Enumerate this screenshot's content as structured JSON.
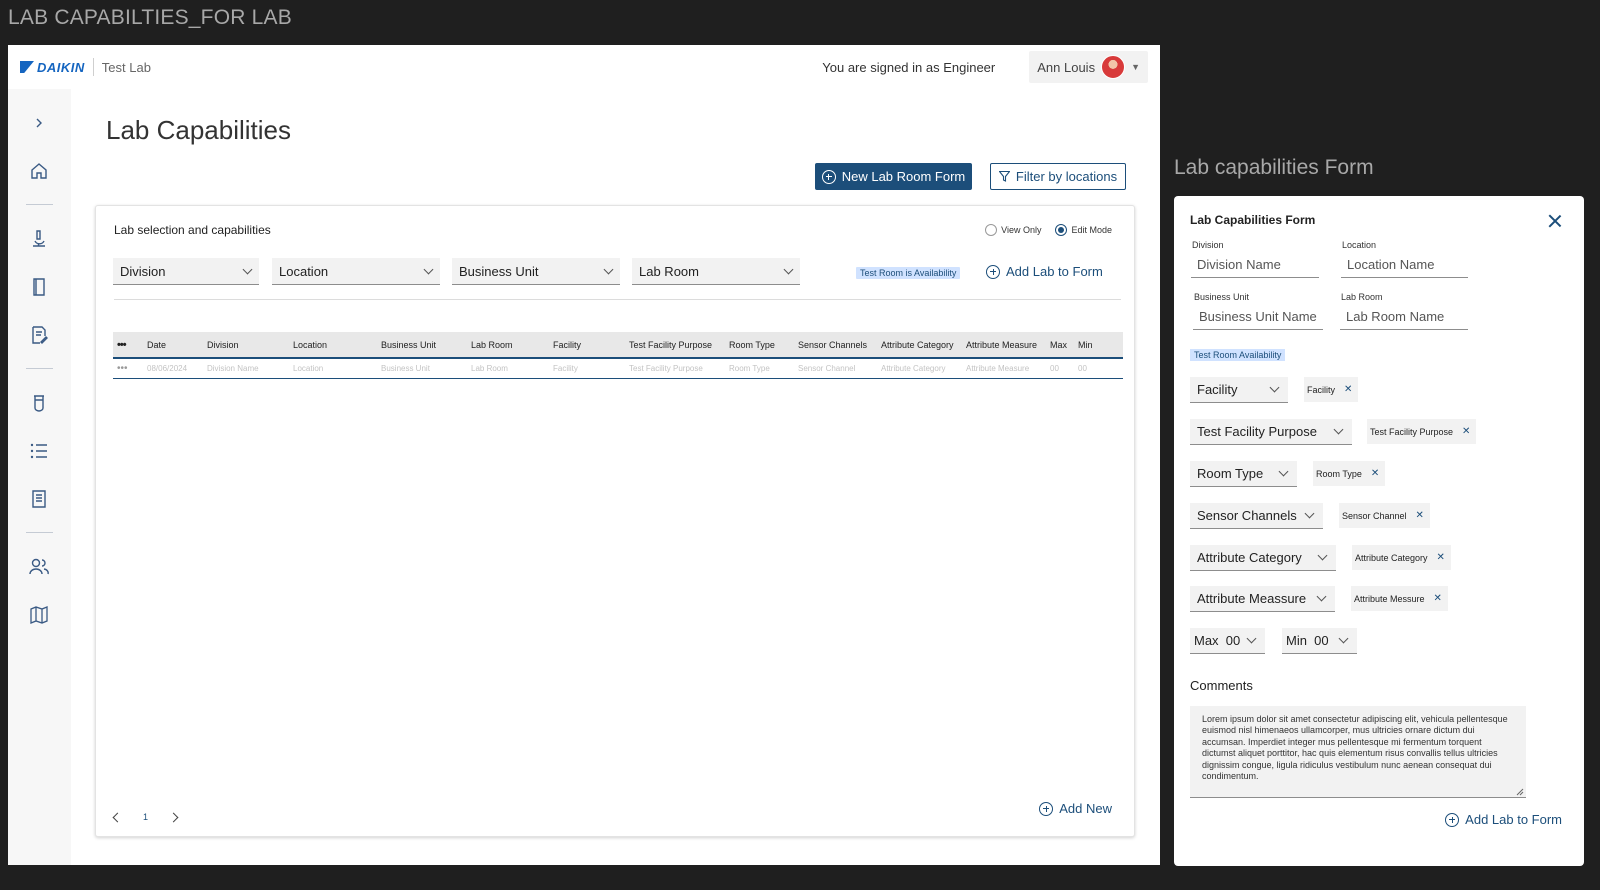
{
  "page_caption": "LAB CAPABILTIES_FOR LAB",
  "form_caption": "Lab capabilities Form",
  "header": {
    "brand": "DAIKIN",
    "sub_brand": "Test Lab",
    "signed_in_text": "You are signed in as Engineer",
    "user_name": "Ann Louis"
  },
  "sidebar": {
    "icons": [
      "chevron-right-icon",
      "home-icon",
      "microscope-icon",
      "book-icon",
      "edit-document-icon",
      "beaker-icon",
      "list-icon",
      "document-icon",
      "users-icon",
      "map-icon"
    ]
  },
  "main": {
    "title": "Lab Capabilities",
    "new_form_button": "New Lab Room Form",
    "filter_button": "Filter by locations",
    "card": {
      "title": "Lab selection and capabilities",
      "modes": [
        {
          "label": "View Only",
          "selected": false
        },
        {
          "label": "Edit Mode",
          "selected": true
        }
      ],
      "filters": {
        "division": "Division",
        "location": "Location",
        "business_unit": "Business Unit",
        "lab_room": "Lab Room"
      },
      "availability_tag": "Test Room is Availability",
      "add_lab_link": "Add Lab to Form",
      "table": {
        "columns": [
          "•••",
          "Date",
          "Division",
          "Location",
          "Business Unit",
          "Lab Room",
          "Facility",
          "Test Facility Purpose",
          "Room Type",
          "Sensor Channels",
          "Attribute Category",
          "Attribute Measure",
          "Max",
          "Min"
        ],
        "rows": [
          [
            "•••",
            "08/06/2024",
            "Division Name",
            "Location",
            "Business Unit",
            "Lab Room",
            "Facility",
            "Test Facility Purpose",
            "Room Type",
            "Sensor Channel",
            "Attribute Category",
            "Attribute Measure",
            "00",
            "00"
          ]
        ]
      },
      "pagination": {
        "page": "1"
      },
      "add_new_link": "Add New"
    }
  },
  "form": {
    "title": "Lab Capabilities Form",
    "division_label": "Division",
    "division_placeholder": "Division Name",
    "location_label": "Location",
    "location_placeholder": "Location Name",
    "business_unit_label": "Business Unit",
    "business_unit_placeholder": "Business Unit Name",
    "lab_room_label": "Lab Room",
    "lab_room_placeholder": "Lab Room Name",
    "availability_tag": "Test Room Availability",
    "selects": [
      {
        "label": "Facility",
        "chip": "Facility"
      },
      {
        "label": "Test Facility Purpose",
        "chip": "Test Facility Purpose"
      },
      {
        "label": "Room Type",
        "chip": "Room Type"
      },
      {
        "label": "Sensor Channels",
        "chip": "Sensor Channel"
      },
      {
        "label": "Attribute Category",
        "chip": "Attribute Category"
      },
      {
        "label": "Attribute Meassure",
        "chip": "Attribute Messure"
      }
    ],
    "max_label": "Max  00",
    "min_label": "Min  00",
    "comments_label": "Comments",
    "comments_text": "Lorem ipsum dolor sit amet consectetur adipiscing elit, vehicula pellentesque euismod nisl himenaeos ullamcorper, mus ultricies ornare dictum dui accumsan. Imperdiet integer mus pellentesque mi fermentum torquent dictumst aliquet porttitor, hac quis elementum risus convallis tellus ultricies dignissim congue, ligula ridiculus vestibulum nunc aenean consequat dui condimentum.",
    "add_lab_link": "Add Lab to Form"
  },
  "colors": {
    "accent": "#1c4e7a",
    "brand": "#1565c0",
    "tag_bg": "#d0e2ff",
    "background": "#1f1f1f"
  }
}
